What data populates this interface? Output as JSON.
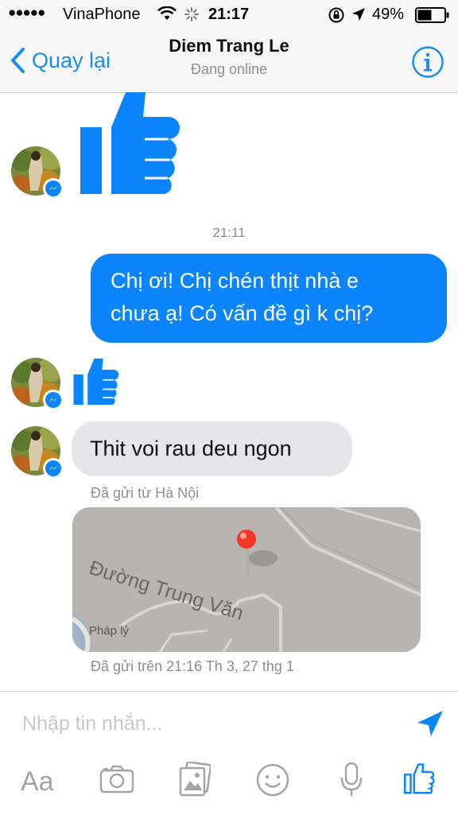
{
  "status_bar": {
    "signal_dots": "●●●●●",
    "carrier": "VinaPhone",
    "time": "21:17",
    "battery_percent": "49%"
  },
  "nav": {
    "back_label": "Quay lại",
    "contact_name": "Diem Trang Le",
    "presence": "Đang online",
    "accent_color": "#1a8cf0"
  },
  "conversation": {
    "timestamp": "21:11",
    "sent_message": {
      "line1": "Chị ơi! Chị chén thịt nhà e",
      "line2": "chưa ạ! Có vấn đề gì k chị?",
      "bubble_color": "#0a84ff"
    },
    "received_message": {
      "text": "Thit voi rau deu ngon",
      "sent_from": "Đã gửi từ Hà Nội"
    },
    "map": {
      "street_label": "Đường Trung Văn",
      "legal_label": "Pháp lý",
      "sent_time": "Đã gửi trên 21:16 Th 3, 27 thg 1"
    }
  },
  "composer": {
    "placeholder": "Nhập tin nhắn...",
    "toolbar_text_label": "Aa",
    "tools": [
      "text-format",
      "camera",
      "photos",
      "emoji",
      "microphone",
      "like"
    ]
  }
}
